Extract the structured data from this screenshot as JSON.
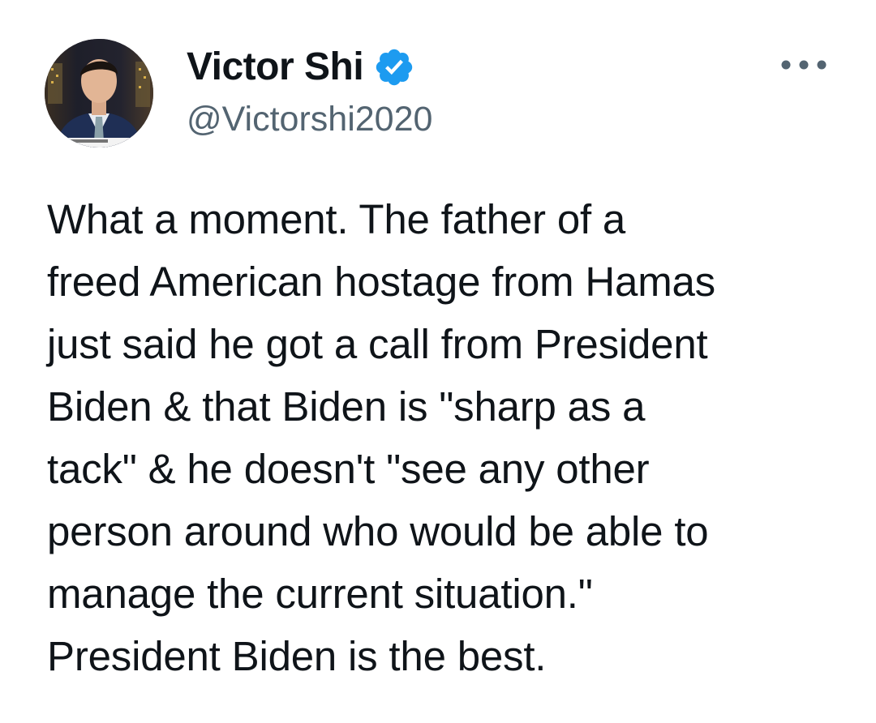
{
  "author": {
    "display_name": "Victor Shi",
    "handle": "@Victorshi2020",
    "verified": true,
    "verified_badge_color": "#1d9bf0"
  },
  "icons": {
    "verified": "verified-badge-icon",
    "more": "more-horizontal-icon",
    "avatar": "profile-photo"
  },
  "tweet": {
    "text": "What a moment. The father of a\nfreed American hostage from Hamas\njust said he got a call from President\nBiden & that Biden is \"sharp as a\ntack\" & he doesn't \"see any other\nperson around who would be able to\nmanage the current situation.\"\nPresident Biden is the best."
  },
  "colors": {
    "text_primary": "#0f1419",
    "text_secondary": "#536471",
    "background": "#ffffff"
  }
}
